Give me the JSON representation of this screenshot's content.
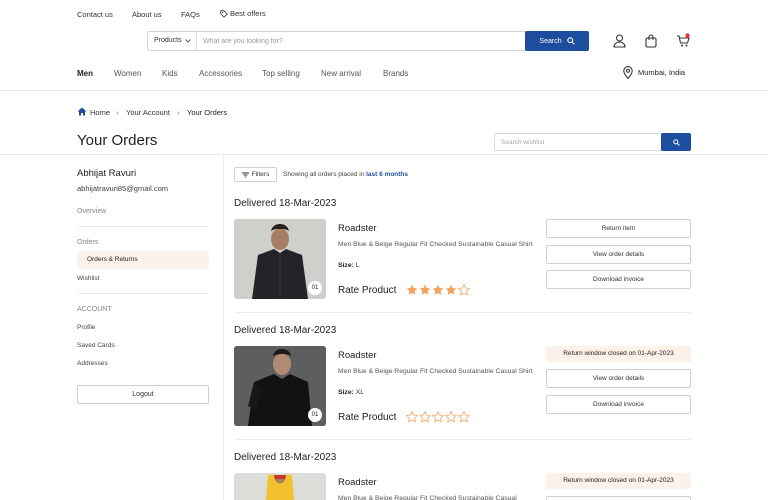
{
  "topbar": {
    "links": [
      "Contact us",
      "About us",
      "FAQs"
    ],
    "offers": "Best offers"
  },
  "search": {
    "category": "Products",
    "placeholder": "What are you looking for?",
    "button": "Search"
  },
  "nav": {
    "items": [
      "Men",
      "Women",
      "Kids",
      "Accessories",
      "Top selling",
      "New arrival",
      "Brands"
    ],
    "active": "Men",
    "location": "Mumbai, India"
  },
  "breadcrumb": [
    "Home",
    "Your Account",
    "Your Orders"
  ],
  "page_title": "Your Orders",
  "wishlist_search": {
    "placeholder": "Search wishlist"
  },
  "sidebar": {
    "name": "Abhijat Ravuri",
    "email": "abhijatravuri85@gmail.com",
    "overview": "Overview",
    "orders_heading": "Orders",
    "orders_returns": "Orders & Returns",
    "wishlist": "Wishlist",
    "account_heading": "ACCOUNT",
    "profile": "Profile",
    "saved_cards": "Saved Cards",
    "addresses": "Addresses",
    "logout": "Logout"
  },
  "filters": {
    "label": "Filters",
    "note_prefix": "Showing all orders placed in",
    "note_period": "last 6 months"
  },
  "orders": [
    {
      "status": "Delivered 18-Mar-2023",
      "brand": "Roadster",
      "desc": "Men Blue & Beige Regular Fit Checked Sustainable Casual Shirt",
      "size_label": "Size:",
      "size": "L",
      "rate_label": "Rate Product",
      "rating": 4,
      "qty": "01",
      "actions": [
        "Return item",
        "View order details",
        "Download invoice"
      ]
    },
    {
      "status": "Delivered 18-Mar-2023",
      "brand": "Roadster",
      "desc": "Men Blue & Beige Regular Fit Checked Sustainable Casual Shirt",
      "size_label": "Size:",
      "size": "XL",
      "rate_label": "Rate Product",
      "rating": 0,
      "qty": "01",
      "return_notice": "Return window closed on 01-Apr-2023",
      "actions": [
        "View order details",
        "Download invoice"
      ]
    },
    {
      "status": "Delivered 18-Mar-2023",
      "brand": "Roadster",
      "desc": "Men Blue & Beige Regular Fit Checked Sustainable Casual",
      "return_notice": "Return window closed on 01-Apr-2023"
    }
  ],
  "colors": {
    "primary": "#1d4e9e",
    "accent_bg": "#fdf2ea",
    "star": "#f0a35e",
    "cart_badge": "#e53935"
  },
  "icons": {
    "offers": "tag-icon",
    "search": "magnifier-icon",
    "account": "user-icon",
    "bag": "bag-icon",
    "cart": "cart-icon",
    "location": "map-pin-icon",
    "home": "home-icon"
  }
}
